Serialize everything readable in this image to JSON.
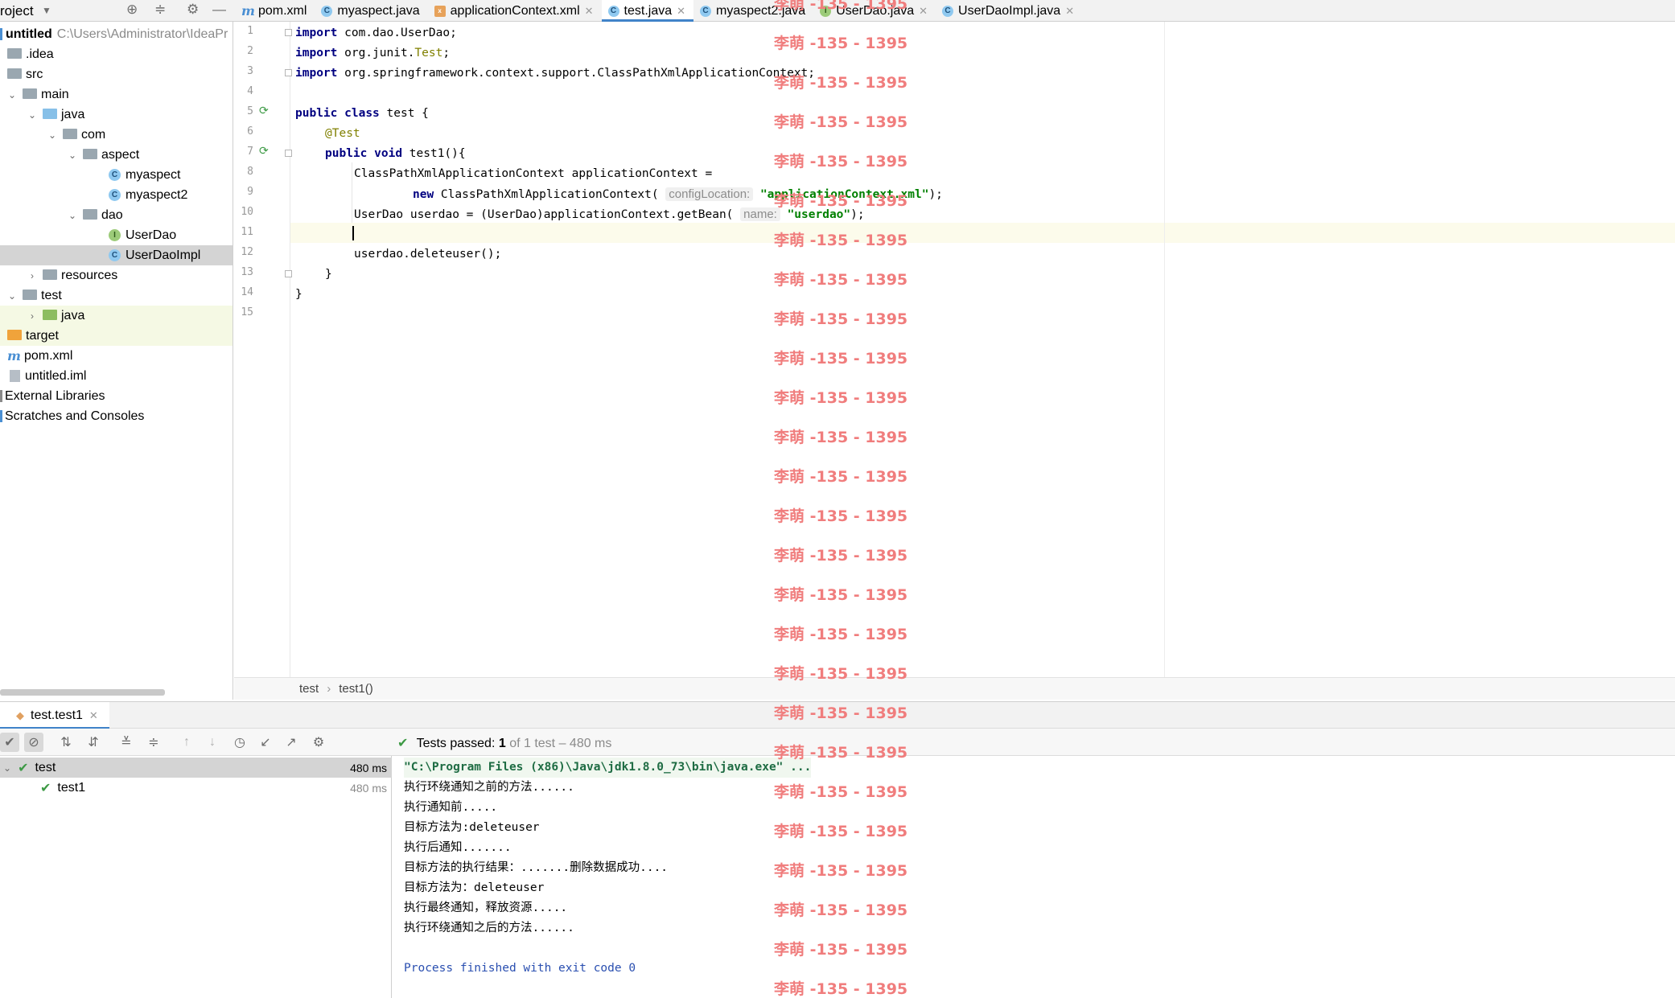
{
  "project": {
    "title": "roject",
    "tree": [
      {
        "label": "untitled",
        "extra": "C:\\Users\\Administrator\\IdeaPr",
        "kind": "module"
      },
      {
        "label": ".idea",
        "kind": "folder"
      },
      {
        "label": "src",
        "kind": "folder"
      },
      {
        "label": "main",
        "kind": "folder"
      },
      {
        "label": "java",
        "kind": "folder-blue"
      },
      {
        "label": "com",
        "kind": "package"
      },
      {
        "label": "aspect",
        "kind": "package"
      },
      {
        "label": "myaspect",
        "kind": "class"
      },
      {
        "label": "myaspect2",
        "kind": "class"
      },
      {
        "label": "dao",
        "kind": "package"
      },
      {
        "label": "UserDao",
        "kind": "interface"
      },
      {
        "label": "UserDaoImpl",
        "kind": "class"
      },
      {
        "label": "resources",
        "kind": "folder"
      },
      {
        "label": "test",
        "kind": "folder"
      },
      {
        "label": "java",
        "kind": "folder-green"
      },
      {
        "label": "target",
        "kind": "folder-orange"
      },
      {
        "label": "pom.xml",
        "kind": "maven"
      },
      {
        "label": "untitled.iml",
        "kind": "file"
      },
      {
        "label": "External Libraries",
        "kind": "libs"
      },
      {
        "label": "Scratches and Consoles",
        "kind": "scratch"
      }
    ]
  },
  "tabs": [
    {
      "label": "pom.xml",
      "icon": "m"
    },
    {
      "label": "myaspect.java",
      "icon": "c"
    },
    {
      "label": "applicationContext.xml",
      "icon": "xml"
    },
    {
      "label": "test.java",
      "icon": "c"
    },
    {
      "label": "myaspect2.java",
      "icon": "c"
    },
    {
      "label": "UserDao.java",
      "icon": "i"
    },
    {
      "label": "UserDaoImpl.java",
      "icon": "c"
    }
  ],
  "code": {
    "line_numbers": [
      "1",
      "2",
      "3",
      "4",
      "5",
      "6",
      "7",
      "8",
      "9",
      "10",
      "11",
      "12",
      "13",
      "14",
      "15"
    ],
    "l1_kw": "import",
    "l1_rest": " com.dao.UserDao;",
    "l2_kw": "import",
    "l2_rest": " org.junit.",
    "l2_ann": "Test",
    "l2_end": ";",
    "l3_kw": "import",
    "l3_rest": " org.springframework.context.support.ClassPathXmlApplicationContext;",
    "l5_kw1": "public",
    "l5_kw2": "class",
    "l5_rest": " test {",
    "l6_ann": "@Test",
    "l7_kw1": "public",
    "l7_kw2": "void",
    "l7_rest": " test1(){",
    "l8": "ClassPathXmlApplicationContext applicationContext =",
    "l9_kw": "new",
    "l9_rest": " ClassPathXmlApplicationContext(",
    "l9_hint": "configLocation:",
    "l9_str": "\"applicationContext.xml\"",
    "l9_end": ");",
    "l10_rest": "UserDao userdao = (UserDao)applicationContext.getBean(",
    "l10_hint": "name:",
    "l10_str": "\"userdao\"",
    "l10_end": ");",
    "l12": "userdao.deleteuser();",
    "l13": "}",
    "l14": "}"
  },
  "breadcrumb": {
    "item1": "test",
    "item2": "test1()"
  },
  "run": {
    "tab_label": "test.test1",
    "status_prefix": "Tests passed:",
    "status_count": "1",
    "status_suffix": "of 1 test – 480 ms",
    "tests": [
      {
        "name": "test",
        "time": "480 ms"
      },
      {
        "name": "test1",
        "time": "480 ms"
      }
    ],
    "console": [
      "\"C:\\Program Files (x86)\\Java\\jdk1.8.0_73\\bin\\java.exe\" ...",
      "执行环绕通知之前的方法......",
      "执行通知前.....",
      "目标方法为:deleteuser",
      "执行后通知.......",
      "目标方法的执行结果：.......删除数据成功....",
      "目标方法为：deleteuser",
      "执行最终通知，释放资源.....",
      "执行环绕通知之后的方法......",
      "Process finished with exit code 0"
    ]
  },
  "watermark": "李萌 -135 - 1395"
}
